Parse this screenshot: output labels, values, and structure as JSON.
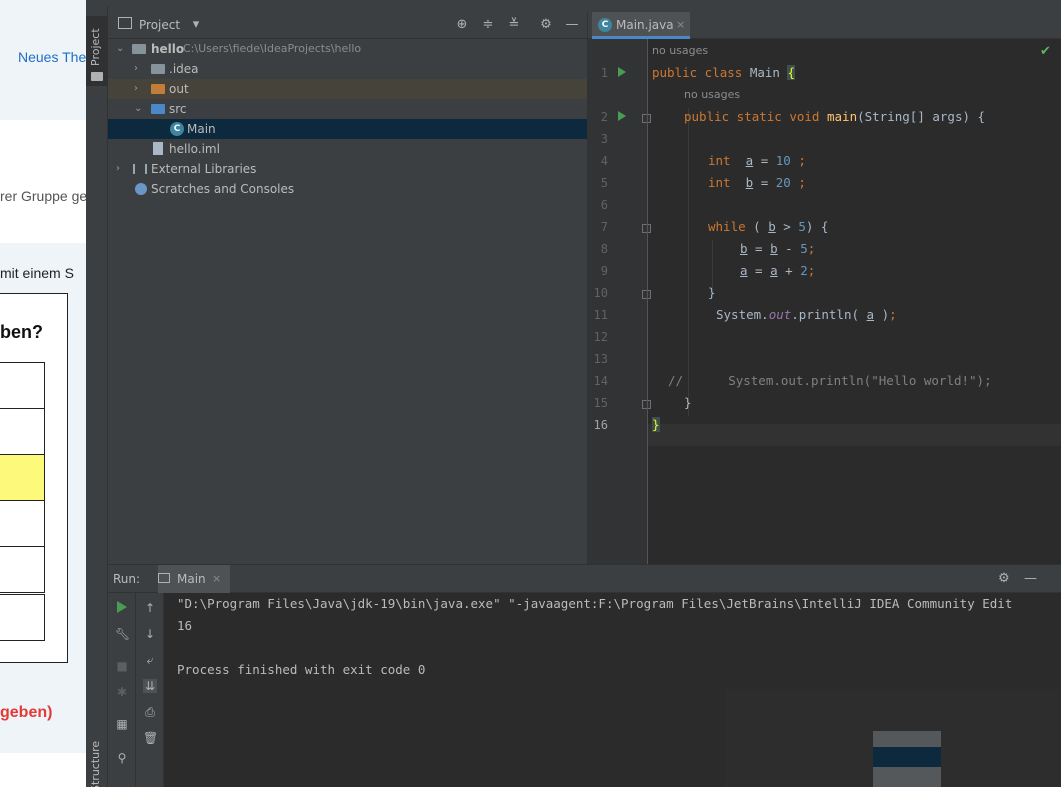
{
  "background_page": {
    "link_text": "Neues The",
    "text_group": "rer Gruppe ge",
    "text_mit": "mit einem S",
    "heading": "ben?",
    "red_text": "geben)"
  },
  "ide": {
    "side_stripe": {
      "project_label": "Project",
      "bottom_label": "Structure"
    },
    "project_panel": {
      "title": "Project",
      "dropdown_icon": "chevron-down-icon",
      "header_icons": [
        "locate-icon",
        "expand-all-icon",
        "collapse-all-icon",
        "gear-icon",
        "minimize-icon"
      ],
      "tree": {
        "root_name": "hello",
        "root_path": "C:\\Users\\fiede\\IdeaProjects\\hello",
        "idea": ".idea",
        "out": "out",
        "src": "src",
        "main": "Main",
        "iml": "hello.iml",
        "ext_libs": "External Libraries",
        "scratches": "Scratches and Consoles"
      }
    },
    "editor": {
      "tab_label": "Main.java",
      "tab_close": "×",
      "check_icon": "✔",
      "hint_no_usages_1": "no usages",
      "hint_no_usages_2": "no usages",
      "line_numbers": [
        "1",
        "2",
        "3",
        "4",
        "5",
        "6",
        "7",
        "8",
        "9",
        "10",
        "11",
        "12",
        "13",
        "14",
        "15",
        "16"
      ]
    },
    "run_panel": {
      "label": "Run:",
      "tab_label": "Main",
      "tab_close": "×",
      "output": [
        "\"D:\\Program Files\\Java\\jdk-19\\bin\\java.exe\" \"-javaagent:F:\\Program Files\\JetBrains\\IntelliJ IDEA Community Edit",
        "16",
        "",
        "Process finished with exit code 0"
      ]
    },
    "colors": {
      "editor_bg": "#2b2b2b",
      "panel_bg": "#3c3f41",
      "keyword": "#cc7832",
      "number": "#6897bb",
      "method": "#ffc66d",
      "string": "#6a8759",
      "selection": "#0d293e",
      "run_green": "#499c54"
    }
  }
}
